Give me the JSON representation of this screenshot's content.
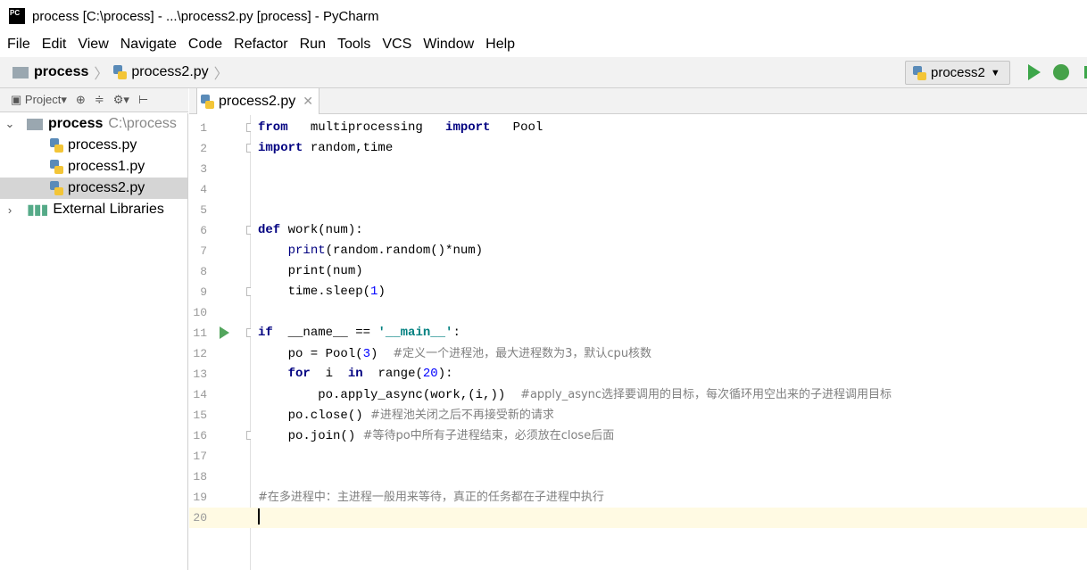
{
  "window": {
    "title": "process [C:\\process] - ...\\process2.py [process] - PyCharm"
  },
  "menu": [
    "File",
    "Edit",
    "View",
    "Navigate",
    "Code",
    "Refactor",
    "Run",
    "Tools",
    "VCS",
    "Window",
    "Help"
  ],
  "breadcrumb": {
    "project": "process",
    "file": "process2.py"
  },
  "run_config": "process2",
  "project_panel": {
    "label": "Project",
    "root": "process",
    "root_path": "C:\\process",
    "files": [
      "process.py",
      "process1.py",
      "process2.py"
    ],
    "selected": "process2.py",
    "external": "External Libraries"
  },
  "tab": {
    "label": "process2.py"
  },
  "editor": {
    "current_line": 20,
    "lines": [
      [
        {
          "t": "from",
          "c": "kw"
        },
        {
          "t": "   multiprocessing   "
        },
        {
          "t": "import",
          "c": "kw"
        },
        {
          "t": "   Pool"
        }
      ],
      [
        {
          "t": "import",
          "c": "kw"
        },
        {
          "t": " random,time"
        }
      ],
      [],
      [],
      [],
      [
        {
          "t": "def",
          "c": "kw"
        },
        {
          "t": " work(num):"
        }
      ],
      [
        {
          "t": "    "
        },
        {
          "t": "print",
          "c": "kw2"
        },
        {
          "t": "(random.random()*num)"
        }
      ],
      [
        {
          "t": "    print(num)"
        }
      ],
      [
        {
          "t": "    time.sleep("
        },
        {
          "t": "1",
          "c": "num"
        },
        {
          "t": ")"
        }
      ],
      [],
      [
        {
          "t": "if",
          "c": "kw"
        },
        {
          "t": "  __name__ == "
        },
        {
          "t": "'__main__'",
          "c": "str"
        },
        {
          "t": ":"
        }
      ],
      [
        {
          "t": "    po = Pool("
        },
        {
          "t": "3",
          "c": "num"
        },
        {
          "t": ")  "
        },
        {
          "t": "#定义一个进程池，最大进程数为3，默认cpu核数",
          "c": "cm"
        }
      ],
      [
        {
          "t": "    "
        },
        {
          "t": "for",
          "c": "kw"
        },
        {
          "t": "  i  "
        },
        {
          "t": "in",
          "c": "kw"
        },
        {
          "t": "  range("
        },
        {
          "t": "20",
          "c": "num"
        },
        {
          "t": "):"
        }
      ],
      [
        {
          "t": "        po.apply_async(work,(i,))  "
        },
        {
          "t": "#apply_async选择要调用的目标，每次循环用空出来的子进程调用目标",
          "c": "cm"
        }
      ],
      [
        {
          "t": "    po.close() "
        },
        {
          "t": "#进程池关闭之后不再接受新的请求",
          "c": "cm"
        }
      ],
      [
        {
          "t": "    po.join() "
        },
        {
          "t": "#等待po中所有子进程结束，必须放在close后面",
          "c": "cm"
        }
      ],
      [],
      [],
      [
        {
          "t": "#在多进程中：主进程一般用来等待，真正的任务都在子进程中执行",
          "c": "cm"
        }
      ],
      []
    ]
  }
}
